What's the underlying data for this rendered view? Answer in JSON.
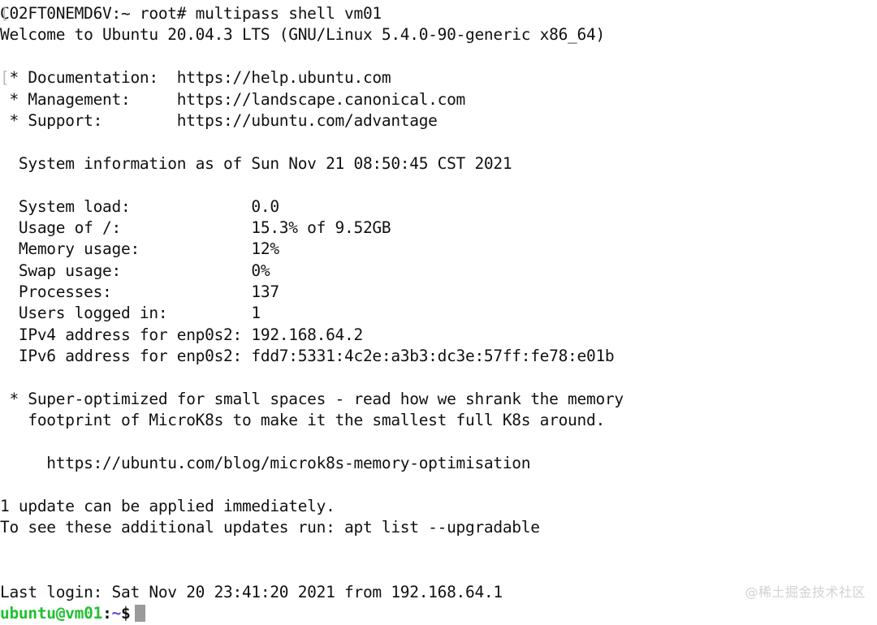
{
  "terminal": {
    "background_color": "#ffffff",
    "foreground_color": "#111111",
    "host_prompt_line": "C02FT0NEMD6V:~ root# multipass shell vm01",
    "edge_artifact_glyph": "[",
    "welcome_line": "Welcome to Ubuntu 20.04.3 LTS (GNU/Linux 5.4.0-90-generic x86_64)",
    "links": {
      "documentation": " * Documentation:  https://help.ubuntu.com",
      "management": " * Management:     https://landscape.canonical.com",
      "support": " * Support:        https://ubuntu.com/advantage"
    },
    "system_information_header": "  System information as of Sun Nov 21 08:50:45 CST 2021",
    "system_info": [
      "  System load:             0.0",
      "  Usage of /:              15.3% of 9.52GB",
      "  Memory usage:            12%",
      "  Swap usage:              0%",
      "  Processes:               137",
      "  Users logged in:         1",
      "  IPv4 address for enp0s2: 192.168.64.2",
      "  IPv6 address for enp0s2: fdd7:5331:4c2e:a3b3:dc3e:57ff:fe78:e01b"
    ],
    "promo": {
      "line1": " * Super-optimized for small spaces - read how we shrank the memory",
      "line2": "   footprint of MicroK8s to make it the smallest full K8s around.",
      "url_line": "     https://ubuntu.com/blog/microk8s-memory-optimisation"
    },
    "updates": {
      "line1": "1 update can be applied immediately.",
      "line2": "To see these additional updates run: apt list --upgradable"
    },
    "last_login": "Last login: Sat Nov 20 23:41:20 2021 from 192.168.64.1",
    "prompt": {
      "user_host": "ubuntu@vm01",
      "colon": ":",
      "path": "~",
      "symbol": "$",
      "user_host_color": "#21c131",
      "path_color": "#5c4bd8",
      "cursor_color": "#9a9a9a"
    }
  },
  "watermark": {
    "text": "@稀土掘金技术社区",
    "color": "#d0d2d5"
  }
}
